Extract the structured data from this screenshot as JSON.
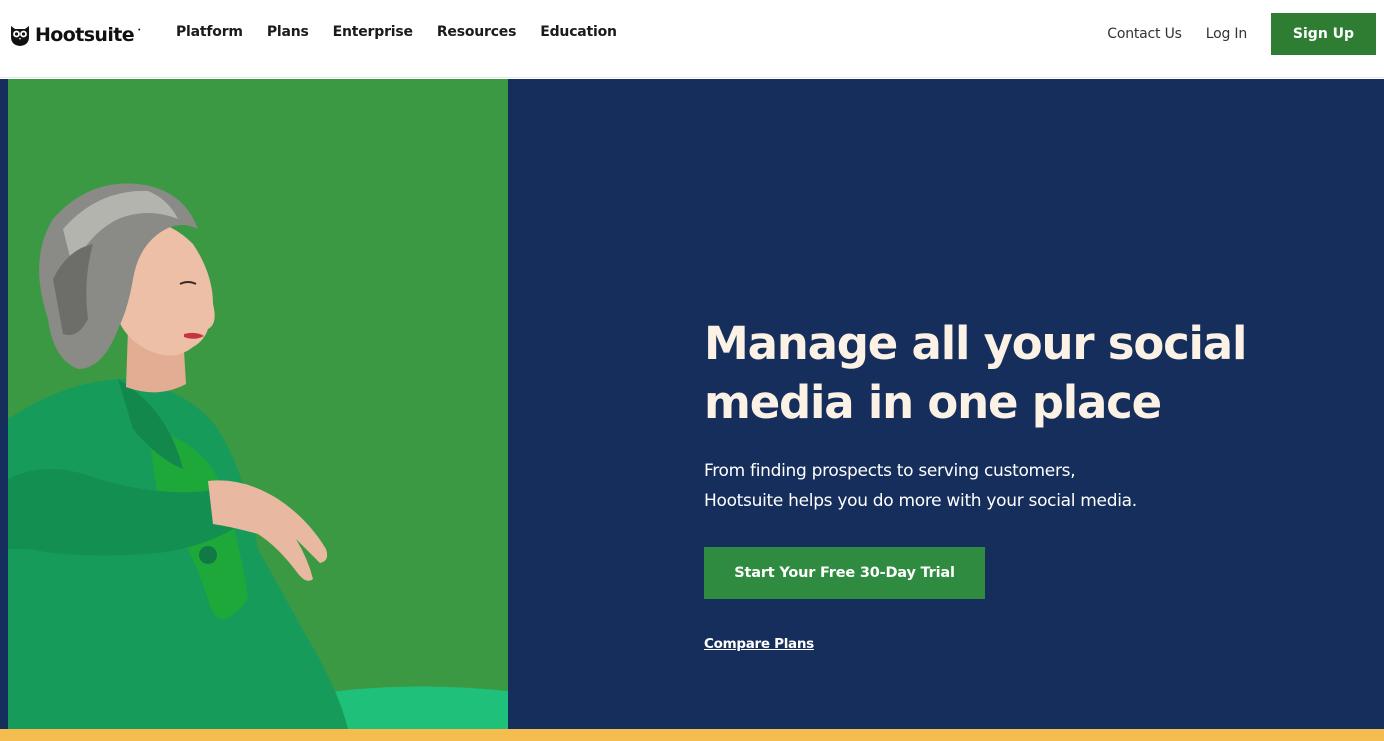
{
  "header": {
    "logo_text": "Hootsuite",
    "logo_mark": "•",
    "nav": [
      {
        "label": "Platform"
      },
      {
        "label": "Plans"
      },
      {
        "label": "Enterprise"
      },
      {
        "label": "Resources"
      },
      {
        "label": "Education"
      }
    ],
    "contact_label": "Contact Us",
    "login_label": "Log In",
    "signup_label": "Sign Up"
  },
  "hero": {
    "headline": "Manage all your social media in one place",
    "subtext_line1": "From finding prospects to serving customers,",
    "subtext_line2": "Hootsuite helps you do more with your social media.",
    "cta_label": "Start Your Free 30-Day Trial",
    "compare_label": "Compare Plans"
  },
  "colors": {
    "brand_green": "#2e7d32",
    "hero_navy": "#162e5b",
    "photo_bg_green": "#3d9a44",
    "headline_cream": "#fbf1e4",
    "bottom_bar_yellow": "#f5bd4f"
  },
  "icons": {
    "logo": "owl-icon"
  }
}
